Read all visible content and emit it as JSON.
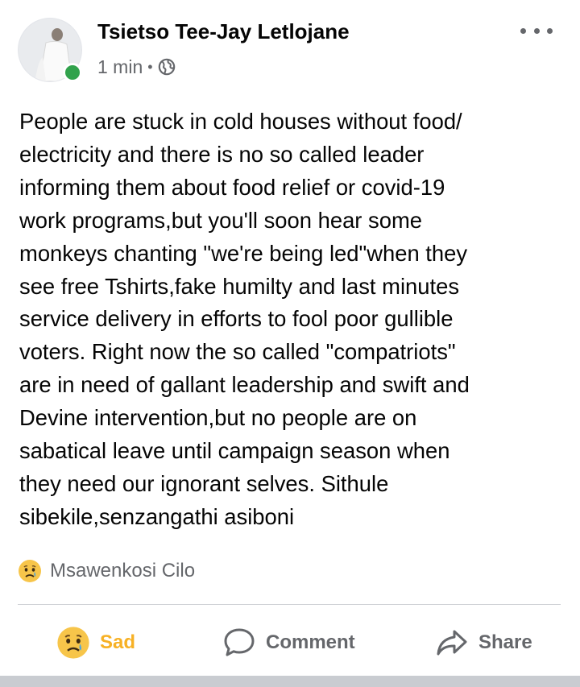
{
  "post": {
    "author": "Tsietso Tee-Jay Letlojane",
    "time": "1 min",
    "separator": "•",
    "audience_icon": "globe-icon",
    "online": true,
    "text": "People are stuck in cold houses without food/\nelectricity and there is no so called leader\ninforming them about food relief or covid-19\nwork programs,but you'll soon hear some\nmonkeys chanting \"we're being led\"when they\nsee free Tshirts,fake humilty and last minutes\nservice delivery in efforts to fool poor gullible\nvoters. Right now the so called \"compatriots\"\nare in need of gallant leadership and swift and\nDevine intervention,but no people are on\nsabatical leave until campaign season when\nthey need our ignorant selves. Sithule\nsibekile,senzangathi asiboni"
  },
  "reactions": {
    "icon": "sad-emoji-icon",
    "names": "Msawenkosi Cilo"
  },
  "actions": {
    "sad_label": "Sad",
    "comment_label": "Comment",
    "share_label": "Share"
  },
  "colors": {
    "online": "#31a24c",
    "sad": "#f7b125",
    "secondary_text": "#65676b"
  }
}
